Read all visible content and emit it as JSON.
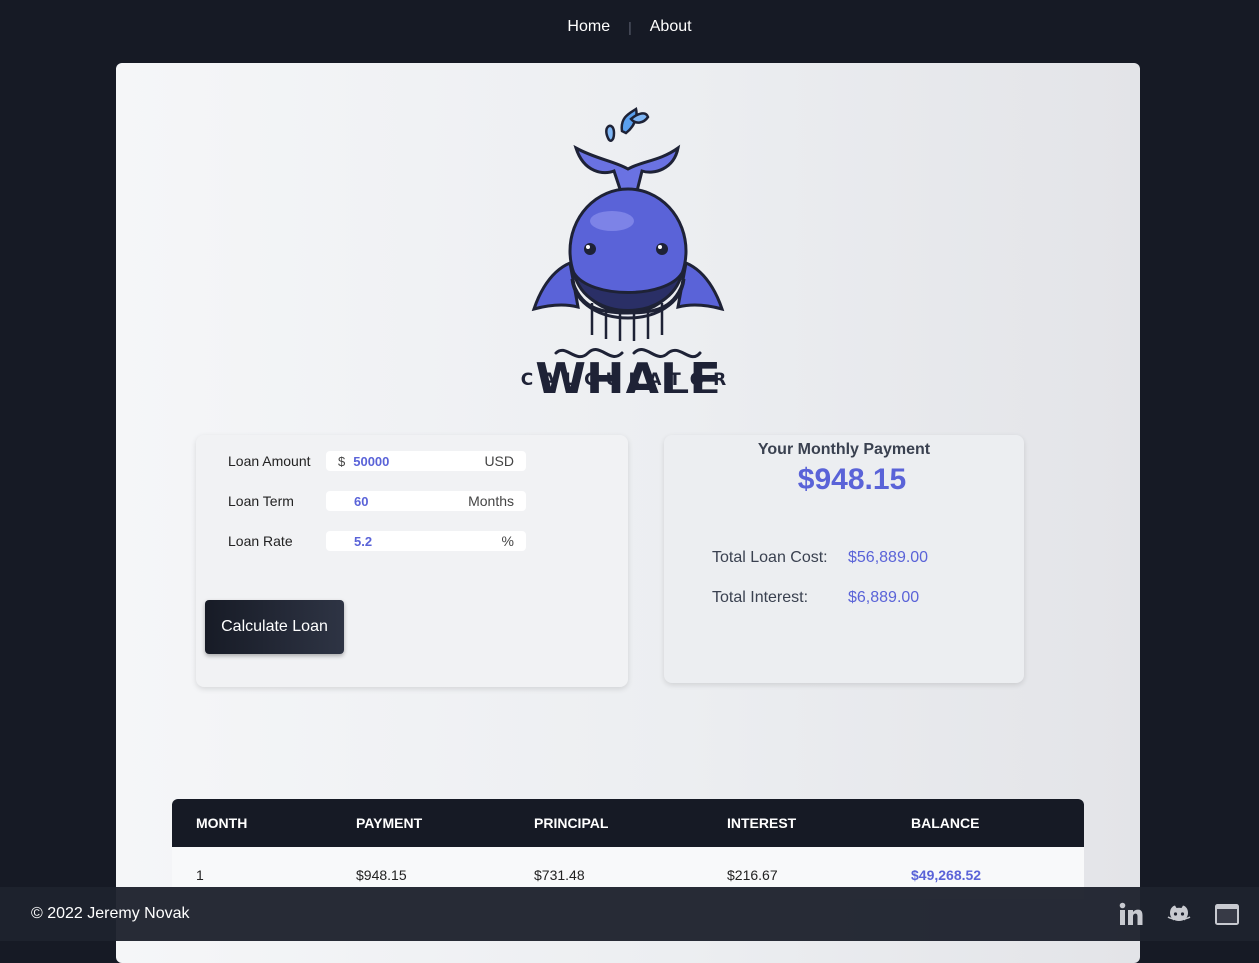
{
  "nav": {
    "home": "Home",
    "separator": "|",
    "about": "About"
  },
  "brand": {
    "name": "WHALE",
    "subtitle": "CALCULATOR",
    "logo_icon": "whale-logo-icon"
  },
  "form": {
    "amount_label": "Loan Amount",
    "amount_prefix": "$",
    "amount_value": "50000",
    "amount_suffix": "USD",
    "term_label": "Loan Term",
    "term_value": "60",
    "term_suffix": "Months",
    "rate_label": "Loan Rate",
    "rate_value": "5.2",
    "rate_suffix": "%",
    "button_label": "Calculate Loan"
  },
  "result": {
    "title": "Your Monthly Payment",
    "amount": "$948.15",
    "total_cost_label": "Total Loan Cost:",
    "total_cost_value": "$56,889.00",
    "total_interest_label": "Total Interest:",
    "total_interest_value": "$6,889.00"
  },
  "table": {
    "headers": [
      "MONTH",
      "PAYMENT",
      "PRINCIPAL",
      "INTEREST",
      "BALANCE"
    ],
    "rows": [
      {
        "month": "1",
        "payment": "$948.15",
        "principal": "$731.48",
        "interest": "$216.67",
        "balance": "$49,268.52"
      }
    ]
  },
  "footer": {
    "copyright": "© 2022 Jeremy Novak",
    "icons": [
      "linkedin-icon",
      "github-icon",
      "browser-window-icon"
    ]
  },
  "colors": {
    "accent": "#5a63d8",
    "dark": "#161a25"
  }
}
